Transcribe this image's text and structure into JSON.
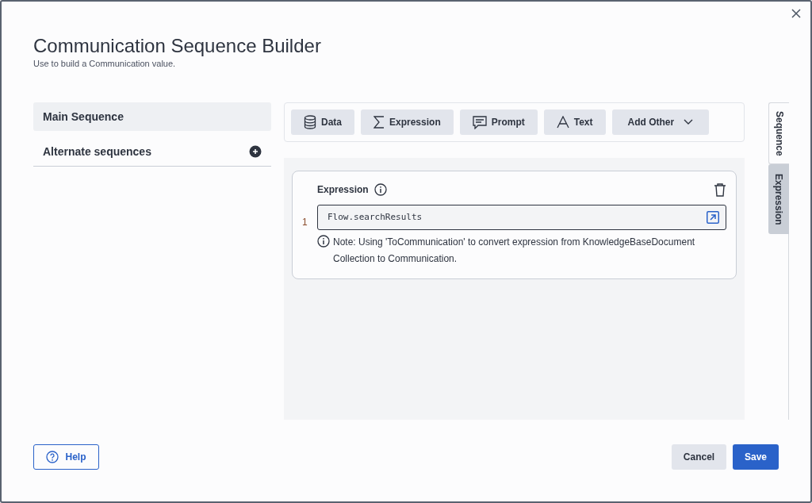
{
  "dialog": {
    "title": "Communication Sequence Builder",
    "subtitle": "Use to build a Communication value."
  },
  "sidebar": {
    "items": [
      {
        "label": "Main Sequence",
        "selected": true,
        "kind": "plain"
      },
      {
        "label": "Alternate sequences",
        "selected": false,
        "kind": "add"
      }
    ]
  },
  "toolbar": {
    "buttons": [
      {
        "label": "Data",
        "kind": "data"
      },
      {
        "label": "Expression",
        "kind": "expression"
      },
      {
        "label": "Prompt",
        "kind": "prompt"
      },
      {
        "label": "Text",
        "kind": "text"
      },
      {
        "label": "Add Other",
        "kind": "dropdown"
      }
    ]
  },
  "expression_card": {
    "title": "Expression",
    "line_number": "1",
    "value": "Flow.searchResults",
    "note": "Note: Using 'ToCommunication' to convert expression from KnowledgeBaseDocument Collection to Communication."
  },
  "side_tabs": [
    {
      "label": "Sequence",
      "selected": true
    },
    {
      "label": "Expression",
      "selected": false
    }
  ],
  "footer": {
    "help": "Help",
    "cancel": "Cancel",
    "save": "Save"
  }
}
